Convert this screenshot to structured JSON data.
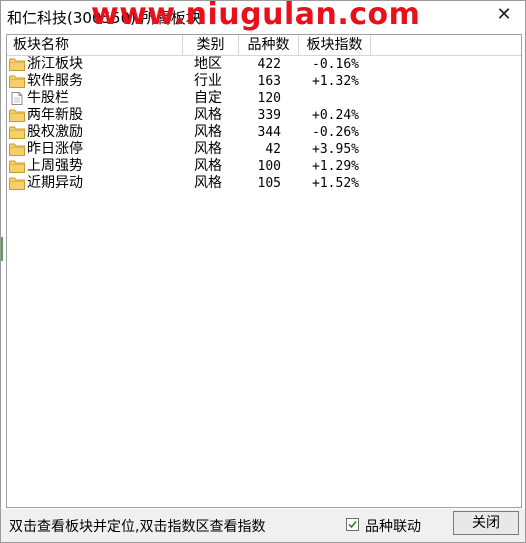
{
  "window": {
    "title": "和仁科技(300550) 所属板块",
    "watermark": "www.niugulan.com",
    "close_glyph": "✕"
  },
  "table": {
    "headers": {
      "name": "板块名称",
      "type": "类别",
      "count": "品种数",
      "index": "板块指数"
    },
    "rows": [
      {
        "icon": "folder-icon",
        "name": "浙江板块",
        "type": "地区",
        "count": "422",
        "index": "-0.16%"
      },
      {
        "icon": "folder-icon",
        "name": "软件服务",
        "type": "行业",
        "count": "163",
        "index": "+1.32%"
      },
      {
        "icon": "document-icon",
        "name": "牛股栏",
        "type": "自定",
        "count": "120",
        "index": ""
      },
      {
        "icon": "folder-icon",
        "name": "两年新股",
        "type": "风格",
        "count": "339",
        "index": "+0.24%"
      },
      {
        "icon": "folder-icon",
        "name": "股权激励",
        "type": "风格",
        "count": "344",
        "index": "-0.26%"
      },
      {
        "icon": "folder-icon",
        "name": "昨日涨停",
        "type": "风格",
        "count": "42",
        "index": "+3.95%"
      },
      {
        "icon": "folder-icon",
        "name": "上周强势",
        "type": "风格",
        "count": "100",
        "index": "+1.29%"
      },
      {
        "icon": "folder-icon",
        "name": "近期异动",
        "type": "风格",
        "count": "105",
        "index": "+1.52%"
      }
    ]
  },
  "status": {
    "hint": "双击查看板块并定位,双击指数区查看指数",
    "checkbox_label": "品种联动",
    "checkbox_checked": true,
    "close_button": "关闭"
  },
  "colors": {
    "watermark": "#e8101a",
    "folder_fill": "#f4cf6a",
    "folder_stroke": "#c99a2e",
    "checkmark": "#2a8a2a"
  }
}
